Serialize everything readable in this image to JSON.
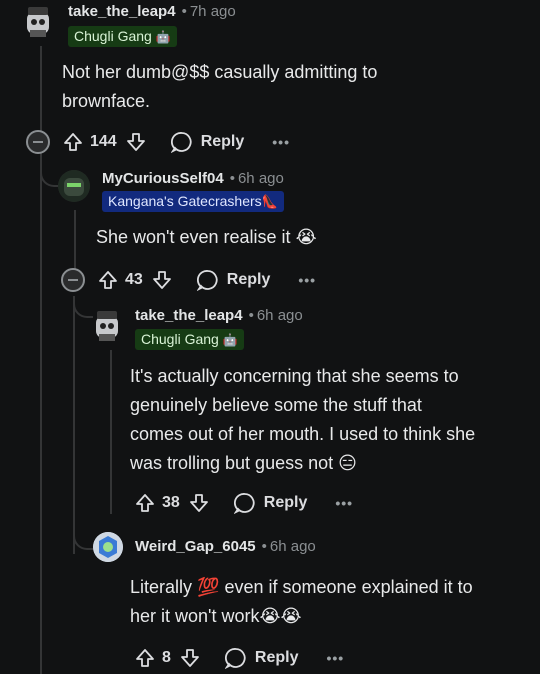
{
  "comments": [
    {
      "username": "take_the_leap4",
      "time": "7h ago",
      "flair": "Chugli Gang",
      "body": "Not her dumb@$$ casually admitting to brownface.",
      "votes": "144",
      "reply": "Reply"
    },
    {
      "username": "MyCuriousSelf04",
      "time": "6h ago",
      "flair": "Kangana's Gatecrashers",
      "body": "She won't even realise it",
      "body_emoji": "😭",
      "votes": "43",
      "reply": "Reply"
    },
    {
      "username": "take_the_leap4",
      "time": "6h ago",
      "flair": "Chugli Gang",
      "body_lines": [
        "It's actually concerning that she seems to",
        "genuinely believe some the stuff that",
        "comes out of her mouth. I used to think she",
        "was trolling but guess not"
      ],
      "body_emoji": "😑",
      "votes": "38",
      "reply": "Reply"
    },
    {
      "username": "Weird_Gap_6045",
      "time": "6h ago",
      "body_part1": "Literally",
      "body_emoji1": "💯",
      "body_part2": "even if someone explained it to",
      "body_line2": "her it won't work",
      "body_emoji2": "😭😭",
      "votes": "8",
      "reply": "Reply"
    }
  ],
  "more_label": "•••",
  "dot": "•",
  "colors": {
    "background": "#111213",
    "thread": "#343536",
    "flair_green": "#163b14",
    "flair_blue": "#122a7e"
  }
}
